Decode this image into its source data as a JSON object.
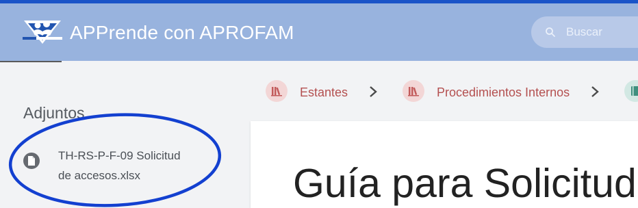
{
  "header": {
    "app_title": "APPrende con APROFAM",
    "search_placeholder": "Buscar",
    "search_icon": "search-icon",
    "logo": "aprofam-logo"
  },
  "breadcrumb": {
    "items": [
      {
        "label": "Estantes",
        "icon": "bookshelf-icon"
      },
      {
        "label": "Procedimientos Internos",
        "icon": "bookshelf-icon"
      },
      {
        "label": "",
        "icon": "book-icon"
      }
    ],
    "separator_icon": "chevron-right-icon"
  },
  "attachments": {
    "title": "Adjuntos",
    "items": [
      {
        "label": "TH-RS-P-F-09 Solicitud de accesos.xlsx",
        "icon": "file-icon"
      }
    ]
  },
  "main": {
    "title": "Guía para Solicitud"
  },
  "colors": {
    "header_bg": "#98b3de",
    "top_accent": "#1a54c8",
    "breadcrumb_text": "#b45050",
    "annotation_circle": "#1340d0"
  }
}
